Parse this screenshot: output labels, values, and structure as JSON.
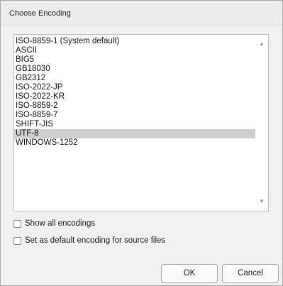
{
  "dialog": {
    "title": "Choose Encoding"
  },
  "encodings": [
    "ISO-8859-1 (System default)",
    "ASCII",
    "BIG5",
    "GB18030",
    "GB2312",
    "ISO-2022-JP",
    "ISO-2022-KR",
    "ISO-8859-2",
    "ISO-8859-7",
    "SHIFT-JIS",
    "UTF-8",
    "WINDOWS-1252"
  ],
  "selected_encoding": "UTF-8",
  "options": {
    "show_all": "Show all encodings",
    "show_all_checked": false,
    "set_default": "Set as default encoding for source files",
    "set_default_checked": false
  },
  "buttons": {
    "ok": "OK",
    "cancel": "Cancel"
  },
  "icons": {
    "scroll_up": "scroll-up-arrow",
    "scroll_down": "scroll-down-arrow"
  }
}
